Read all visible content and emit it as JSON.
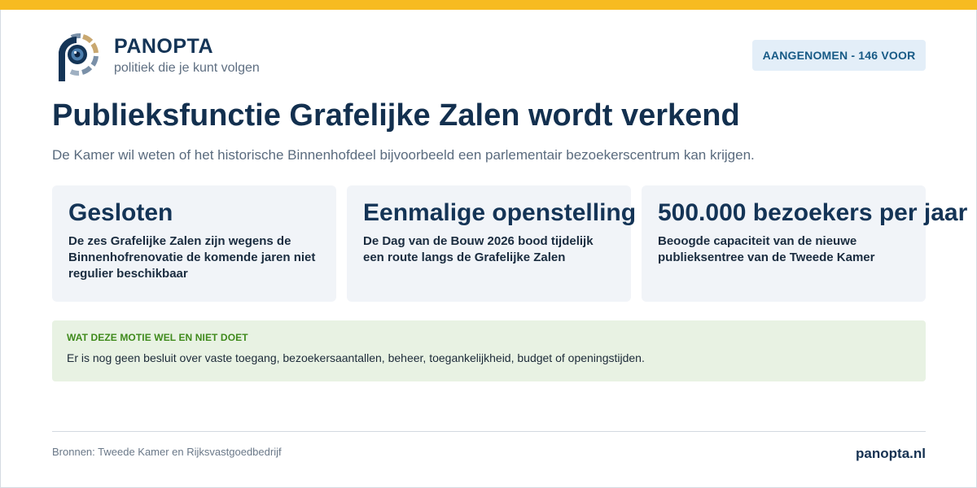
{
  "brand": {
    "name": "PANOPTA",
    "tagline": "politiek die je kunt volgen"
  },
  "status": {
    "label": "AANGENOMEN - 146 VOOR"
  },
  "headline": "Publieksfunctie Grafelijke Zalen wordt verkend",
  "subtitle": "De Kamer wil weten of het historische Binnenhofdeel bijvoorbeeld een parlementair bezoekerscentrum kan krijgen.",
  "stats": [
    {
      "value": "Gesloten",
      "description": "De zes Grafelijke Zalen zijn wegens de Binnenhofrenovatie de komende jaren niet regulier beschikbaar"
    },
    {
      "value": "Eenmalige openstelling",
      "description": "De Dag van de Bouw 2026 bood tijdelijk een route langs de Grafelijke Zalen"
    },
    {
      "value": "500.000 bezoekers per jaar",
      "description": "Beoogde capaciteit van de nieuwe publieksentree van de Tweede Kamer"
    }
  ],
  "motion": {
    "label": "WAT DEZE MOTIE WEL EN NIET DOET",
    "text": "Er is nog geen besluit over vaste toegang, bezoekersaantallen, beheer, toegankelijkheid, budget of openingstijden."
  },
  "footer": {
    "sources": "Bronnen: Tweede Kamer en Rijksvastgoedbedrijf",
    "site": "panopta.nl"
  },
  "colors": {
    "accent_bar": "#f7bb21",
    "brand_navy": "#143456",
    "badge_bg": "#e3eef8",
    "card_bg": "#f1f4f8",
    "motion_bg": "#e8f2e3",
    "motion_label": "#3f8a1c"
  },
  "icons": {
    "logo": "panopta-eye-logo"
  }
}
